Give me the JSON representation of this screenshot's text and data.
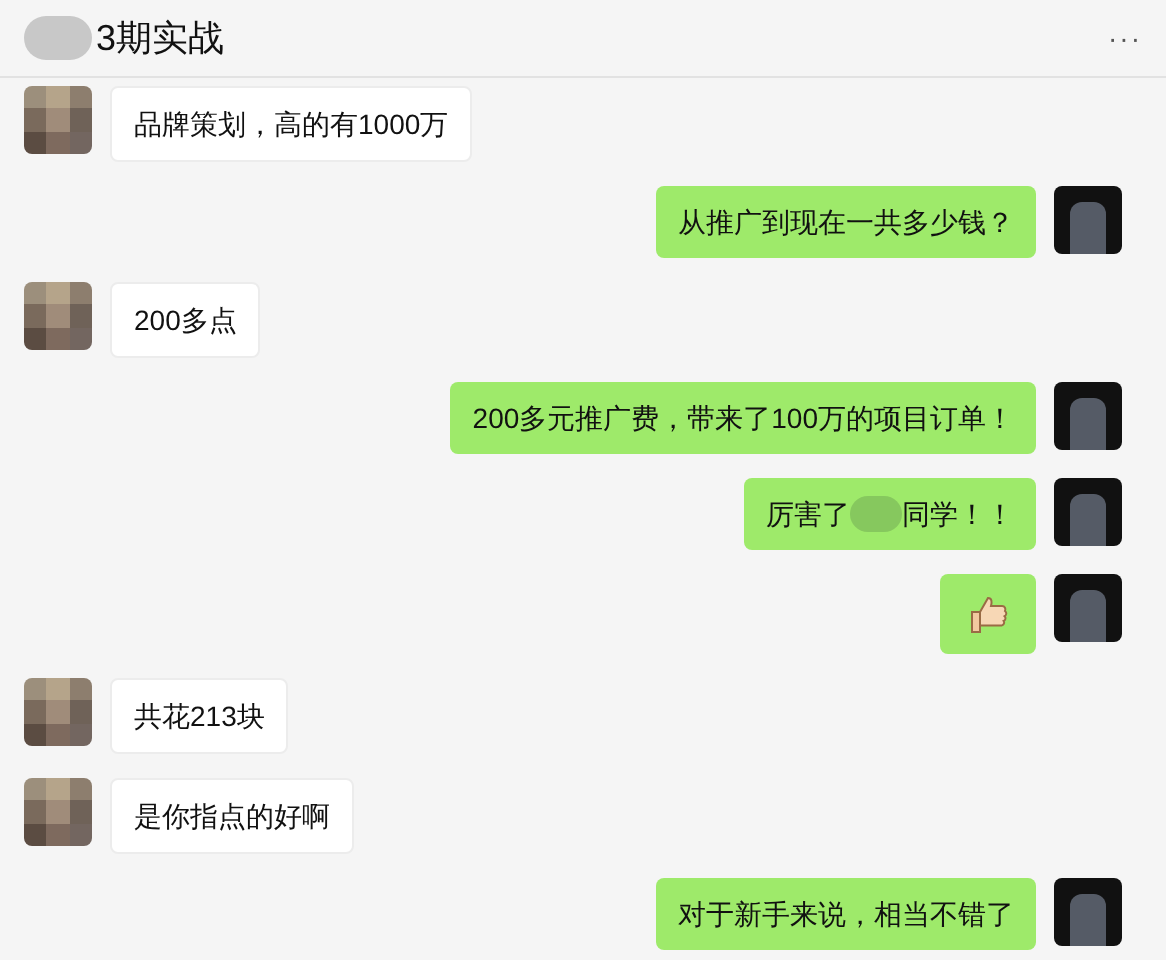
{
  "header": {
    "title": "3期实战",
    "menu": "···"
  },
  "messages": [
    {
      "outgoing": false,
      "kind": "text",
      "parts": [
        {
          "kind": "text",
          "text": "品牌策划，高的有1000万"
        }
      ]
    },
    {
      "outgoing": true,
      "kind": "text",
      "parts": [
        {
          "kind": "text",
          "text": "从推广到现在一共多少钱？"
        }
      ]
    },
    {
      "outgoing": false,
      "kind": "text",
      "parts": [
        {
          "kind": "text",
          "text": "200多点"
        }
      ]
    },
    {
      "outgoing": true,
      "kind": "text",
      "parts": [
        {
          "kind": "text",
          "text": "200多元推广费，带来了100万的项目订单！"
        }
      ]
    },
    {
      "outgoing": true,
      "kind": "text",
      "parts": [
        {
          "kind": "text",
          "text": "厉害了"
        },
        {
          "kind": "redacted"
        },
        {
          "kind": "text",
          "text": "同学！！"
        }
      ]
    },
    {
      "outgoing": true,
      "kind": "emoji"
    },
    {
      "outgoing": false,
      "kind": "text",
      "parts": [
        {
          "kind": "text",
          "text": "共花213块"
        }
      ]
    },
    {
      "outgoing": false,
      "kind": "text",
      "parts": [
        {
          "kind": "text",
          "text": "是你指点的好啊"
        }
      ]
    },
    {
      "outgoing": true,
      "kind": "text",
      "parts": [
        {
          "kind": "text",
          "text": "对于新手来说，相当不错了"
        }
      ]
    }
  ]
}
